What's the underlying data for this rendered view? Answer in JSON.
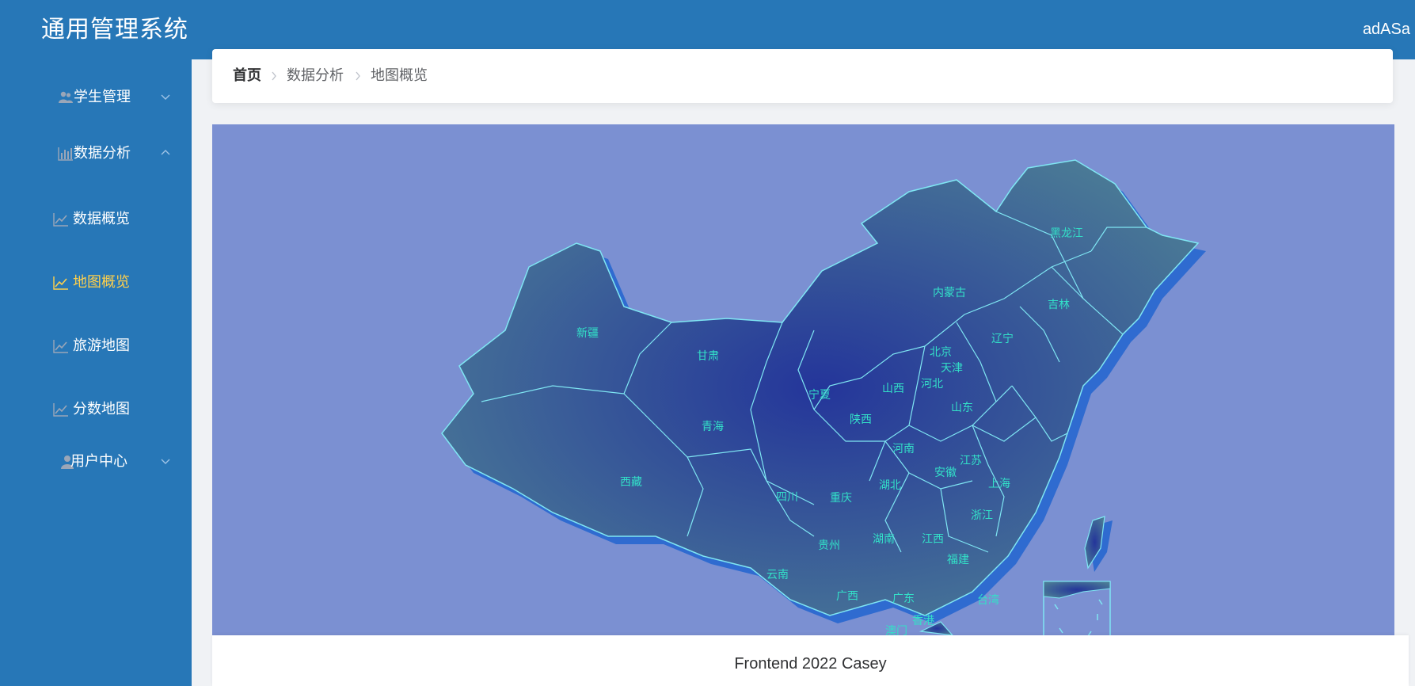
{
  "app": {
    "title": "通用管理系统",
    "user": "adASa"
  },
  "sidebar": {
    "items": [
      {
        "label": "学生管理",
        "icon": "users-icon",
        "expanded": false
      },
      {
        "label": "数据分析",
        "icon": "bar-chart-icon",
        "expanded": true
      },
      {
        "label": "数据概览",
        "icon": "line-chart-icon",
        "active": false
      },
      {
        "label": "地图概览",
        "icon": "line-chart-icon",
        "active": true
      },
      {
        "label": "旅游地图",
        "icon": "line-chart-icon",
        "active": false
      },
      {
        "label": "分数地图",
        "icon": "line-chart-icon",
        "active": false
      },
      {
        "label": "用户中心",
        "icon": "user-icon",
        "expanded": false
      }
    ]
  },
  "breadcrumb": [
    "首页",
    "数据分析",
    "地图概览"
  ],
  "map": {
    "provinces": [
      "黑龙江",
      "吉林",
      "辽宁",
      "内蒙古",
      "北京",
      "天津",
      "河北",
      "山西",
      "山东",
      "新疆",
      "甘肃",
      "宁夏",
      "陕西",
      "青海",
      "西藏",
      "四川",
      "重庆",
      "湖北",
      "河南",
      "安徽",
      "江苏",
      "上海",
      "浙江",
      "湖南",
      "江西",
      "福建",
      "贵州",
      "云南",
      "广西",
      "广东",
      "香港",
      "澳门",
      "台湾"
    ]
  },
  "footer": {
    "text": "Frontend 2022 Casey"
  },
  "colors": {
    "header": "#2777b7",
    "active_menu": "#ffd04b",
    "map_bg": "#7b90d2",
    "province_label": "#33e0c8"
  }
}
